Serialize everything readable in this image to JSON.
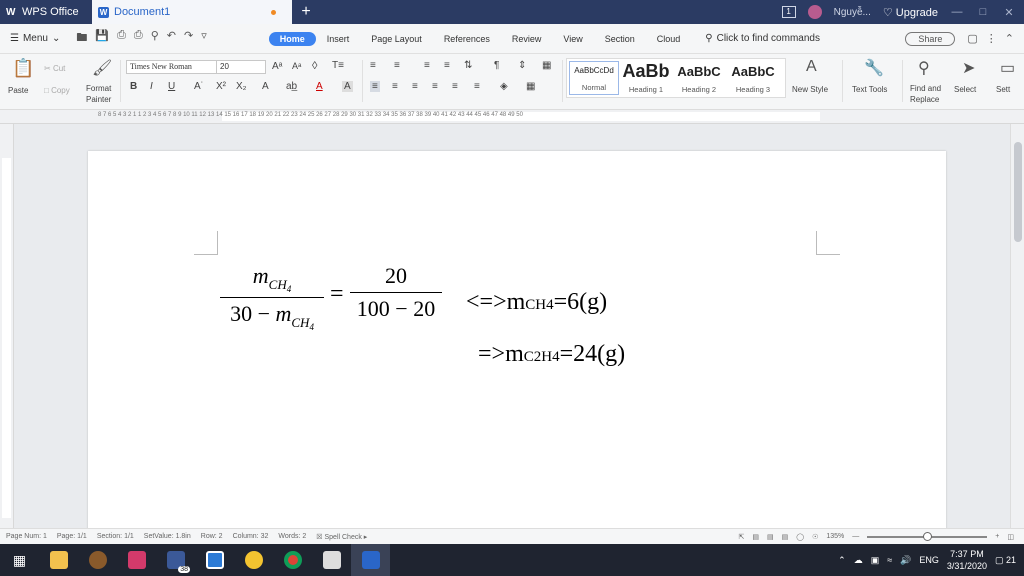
{
  "titlebar": {
    "app_name": "WPS Office",
    "doc_tab": "Document1",
    "new_tab": "+",
    "badge": "1",
    "user": "Nguyễ...",
    "upgrade": "Upgrade"
  },
  "menubar": {
    "menu_label": "Menu",
    "tabs": [
      "Home",
      "Insert",
      "Page Layout",
      "References",
      "Review",
      "View",
      "Section",
      "Cloud"
    ],
    "find_command": "Click to find commands",
    "share": "Share"
  },
  "ribbon": {
    "paste": "Paste",
    "cut": "Cut",
    "copy": "Copy",
    "format_painter_1": "Format",
    "format_painter_2": "Painter",
    "font_name": "Times New Roman",
    "font_size": "20",
    "styles": [
      {
        "preview": "AaBbCcDd",
        "label": "Normal"
      },
      {
        "preview": "AaBb",
        "label": "Heading 1"
      },
      {
        "preview": "AaBbC",
        "label": "Heading 2"
      },
      {
        "preview": "AaBbC",
        "label": "Heading 3"
      }
    ],
    "new_style": "New Style",
    "text_tools": "Text Tools",
    "find_replace_1": "Find and",
    "find_replace_2": "Replace",
    "select": "Select",
    "settings": "Sett"
  },
  "ruler": {
    "numbers": "8  7  6  5  4  3  2  1     1  2  3  4  5  6  7  8  9  10  11  12  13  14  15  16  17  18  19  20  21  22  23  24  25  26  27  28  29  30  31  32  33  34  35  36  37  38  39  40  41  42  43  44  45  46  47  48  49  50"
  },
  "document": {
    "num_m": "m",
    "num_sub": "CH",
    "num_sub4": "4",
    "den_prefix": "30 − ",
    "den_m": "m",
    "den_sub": "CH",
    "den_sub4": "4",
    "equals": "=",
    "rhs_num": "20",
    "rhs_den": "100 − 20",
    "line1_prefix": "<=>m",
    "line1_sub": "CH4",
    "line1_suffix": "=6(g)",
    "line2_prefix": "=>m",
    "line2_sub": "C2H4",
    "line2_suffix": "=24(g)"
  },
  "statusbar": {
    "page_num": "Page Num: 1",
    "page": "Page: 1/1",
    "section": "Section: 1/1",
    "set_value": "SetValue: 1.8in",
    "row": "Row: 2",
    "column": "Column: 32",
    "words": "Words: 2",
    "spell_check": "Spell Check",
    "zoom": "135%"
  },
  "taskbar": {
    "facebook_badge": "38",
    "lang": "ENG",
    "time": "7:37 PM",
    "date": "3/31/2020",
    "notifications": "21"
  }
}
